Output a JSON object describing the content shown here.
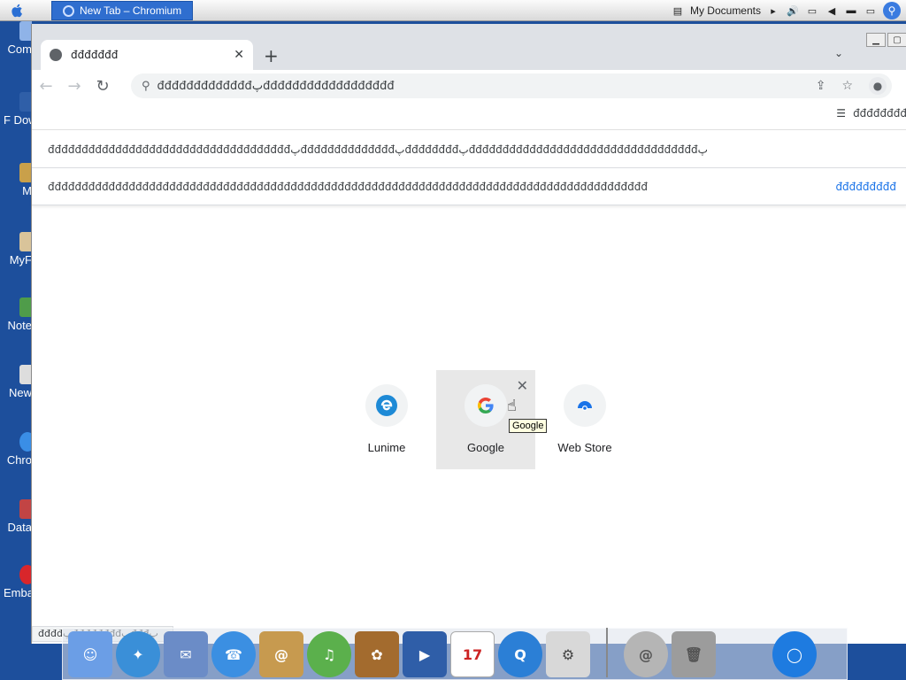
{
  "menubar": {
    "active_task": "New Tab – Chromium",
    "location": "My Documents"
  },
  "desktop_icons": [
    {
      "label": "Com"
    },
    {
      "label": "F Dow"
    },
    {
      "label": "M"
    },
    {
      "label": "MyF"
    },
    {
      "label": "Note"
    },
    {
      "label": "New"
    },
    {
      "label": "Chro"
    },
    {
      "label": "Data"
    },
    {
      "label": "Emba Dev"
    }
  ],
  "browser": {
    "tab_title": "đđđđđđđ",
    "omnibox_text": "đđđđđđđđđđđđđپđđđđđđđđđđđđđđđđđđ",
    "reading_list": "đđđđđđđđ",
    "notice1": "đđđđđđđđđđđđđđđđđđđđđđđđđđđđđđđđđđđđپđđđđđđđđđđđđđđپđđđđđđđđپđđđđđđđđđđđđđđđđđđđđđđđđđđđđđđđđđđپ",
    "notice2": "đđđđđđđđđđđđđđđđđđđđđđđđđđđđđđđđđđđđđđđđđđđđđđđđđđđđđđđđđđđđđđđđđđđđđđđđđđđđđđđđđđđđđđđđđ",
    "notice2_action": "đđđđđđđđđ",
    "status_text": "đđđđپđđđđđđđđپđđđپ"
  },
  "shortcuts": [
    {
      "label": "Lunime",
      "icon": "lunime-icon"
    },
    {
      "label": "Google",
      "icon": "google-icon"
    },
    {
      "label": "Web Store",
      "icon": "web-store-icon"
    }
  ],
  "tooltip": "Google",
  "dock_items": [
    "Finder",
    "Safari",
    "Mail",
    "iChat",
    "Address Book",
    "iTunes",
    "iPhoto",
    "iMovie",
    "iCal",
    "QuickTime",
    "System Preferences",
    "Mail Server",
    "Trash",
    "Chromium"
  ],
  "ical_date": "17",
  "colors": {
    "accent": "#1a73e8",
    "tab_bg": "#dee1e6",
    "desktop": "#1d4f9c"
  }
}
